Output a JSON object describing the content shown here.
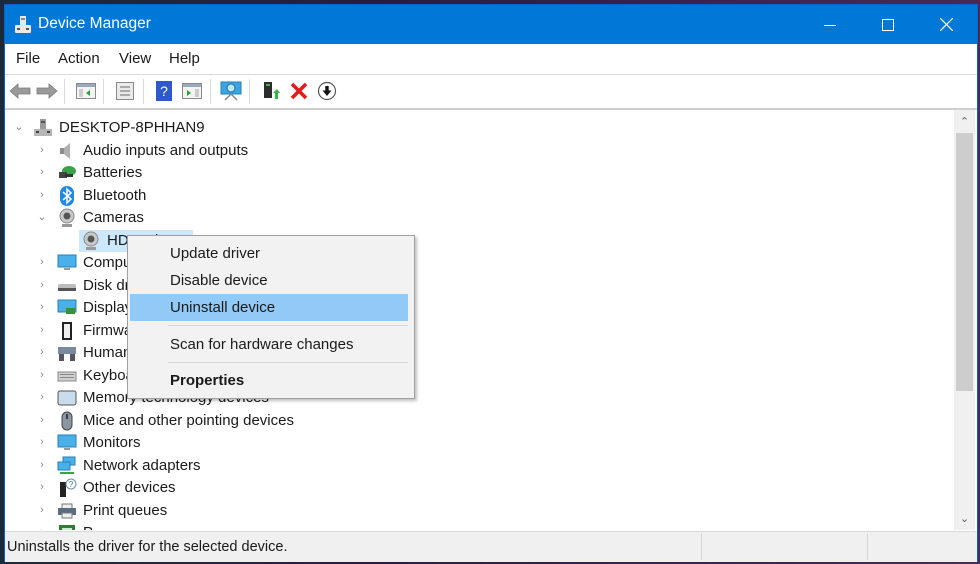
{
  "window": {
    "title": "Device Manager",
    "controls": {
      "minimize": "minimize",
      "maximize": "maximize",
      "close": "close"
    },
    "accent_color": "#0078d7"
  },
  "menubar": {
    "items": [
      {
        "label": "File"
      },
      {
        "label": "Action"
      },
      {
        "label": "View"
      },
      {
        "label": "Help"
      }
    ]
  },
  "toolbar": {
    "buttons": [
      {
        "name": "back",
        "icon": "arrow-left-icon"
      },
      {
        "name": "forward",
        "icon": "arrow-right-icon"
      },
      {
        "name": "show-hide-console-tree",
        "icon": "console-tree-icon"
      },
      {
        "name": "properties",
        "icon": "properties-sheet-icon"
      },
      {
        "name": "help",
        "icon": "help-icon"
      },
      {
        "name": "show-action-pane",
        "icon": "action-pane-icon"
      },
      {
        "name": "scan-hardware",
        "icon": "monitor-scan-icon"
      },
      {
        "name": "update-driver",
        "icon": "update-driver-icon"
      },
      {
        "name": "uninstall-device",
        "icon": "red-x-icon"
      },
      {
        "name": "disable-device",
        "icon": "down-arrow-circle-icon"
      }
    ]
  },
  "tree": {
    "root": {
      "label": "DESKTOP-8PHHAN9",
      "expanded": true,
      "icon": "computer-tower-icon"
    },
    "items": [
      {
        "label": "Audio inputs and outputs",
        "icon": "speaker-icon",
        "expanded": false
      },
      {
        "label": "Batteries",
        "icon": "battery-icon",
        "expanded": false
      },
      {
        "label": "Bluetooth",
        "icon": "bluetooth-icon",
        "expanded": false
      },
      {
        "label": "Cameras",
        "icon": "camera-icon",
        "expanded": true,
        "children": [
          {
            "label": "HD WebCam",
            "icon": "camera-icon",
            "selected": true
          }
        ]
      },
      {
        "label": "Computers",
        "icon": "monitor-icon",
        "expanded": false
      },
      {
        "label": "Disk drives",
        "icon": "disk-drive-icon",
        "expanded": false
      },
      {
        "label": "Display adapters",
        "icon": "display-adapter-icon",
        "expanded": false
      },
      {
        "label": "Firmware",
        "icon": "chip-icon",
        "expanded": false
      },
      {
        "label": "Human Interface Devices",
        "icon": "hid-icon",
        "expanded": false
      },
      {
        "label": "Keyboards",
        "icon": "keyboard-icon",
        "expanded": false
      },
      {
        "label": "Memory technology devices",
        "icon": "memory-icon",
        "expanded": false
      },
      {
        "label": "Mice and other pointing devices",
        "icon": "mouse-icon",
        "expanded": false
      },
      {
        "label": "Monitors",
        "icon": "monitor-icon",
        "expanded": false
      },
      {
        "label": "Network adapters",
        "icon": "network-icon",
        "expanded": false
      },
      {
        "label": "Other devices",
        "icon": "unknown-device-icon",
        "expanded": false
      },
      {
        "label": "Print queues",
        "icon": "printer-icon",
        "expanded": false
      },
      {
        "label": "P",
        "icon": "processor-icon",
        "expanded": false
      }
    ],
    "selection_color": "#cce8ff"
  },
  "context_menu": {
    "items": [
      {
        "label": "Update driver"
      },
      {
        "label": "Disable device"
      },
      {
        "label": "Uninstall device",
        "highlighted": true
      },
      {
        "separator": true
      },
      {
        "label": "Scan for hardware changes"
      },
      {
        "separator": true
      },
      {
        "label": "Properties",
        "bold": true
      }
    ],
    "highlight_color": "#91c9f7"
  },
  "scrollbar": {
    "position_fraction": 0.0,
    "visible_fraction": 0.62
  },
  "statusbar": {
    "text": "Uninstalls the driver for the selected device."
  }
}
